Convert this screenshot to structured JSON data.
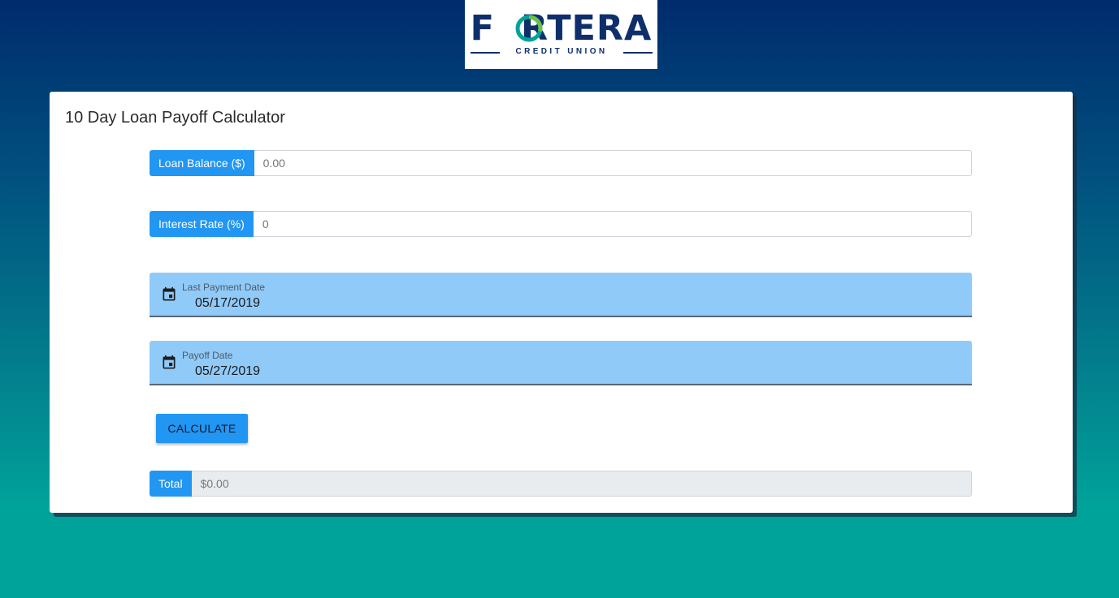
{
  "logo": {
    "wordmark": "FORTERA",
    "subtitle": "CREDIT UNION",
    "colors": {
      "navy": "#0e2f6b",
      "ring_green": "#6cc04a",
      "ring_teal": "#00a39a"
    }
  },
  "calculator": {
    "title": "10 Day Loan Payoff Calculator",
    "loan_balance": {
      "label": "Loan Balance ($)",
      "placeholder": "0.00"
    },
    "interest_rate": {
      "label": "Interest Rate (%)",
      "placeholder": "0"
    },
    "last_payment_date": {
      "label": "Last Payment Date",
      "value": "05/17/2019",
      "icon": "calendar-icon"
    },
    "payoff_date": {
      "label": "Payoff Date",
      "value": "05/27/2019",
      "icon": "calendar-icon"
    },
    "calculate_button": "CALCULATE",
    "total": {
      "label": "Total",
      "value": "$0.00"
    }
  },
  "theme": {
    "accent": "#2196f3",
    "date_field_bg": "#90caf9",
    "gradient_top": "#002b6d",
    "gradient_bottom": "#00a39a"
  }
}
